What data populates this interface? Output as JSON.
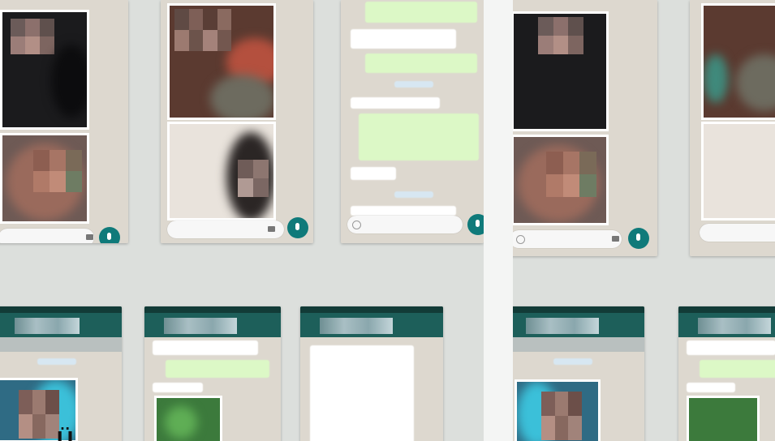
{
  "image": {
    "description_free": true,
    "caption_glyph": "Ü",
    "panels": [
      "left-collage",
      "right-collage"
    ],
    "colors": {
      "chat_background": "#ddd8cf",
      "outgoing_bubble": "#dcf8c6",
      "incoming_bubble": "#ffffff",
      "mic_button": "#0f7a7a",
      "toolbar": "#1d5f5a"
    },
    "icons": [
      "mic-icon",
      "camera-icon",
      "emoji-icon"
    ]
  }
}
